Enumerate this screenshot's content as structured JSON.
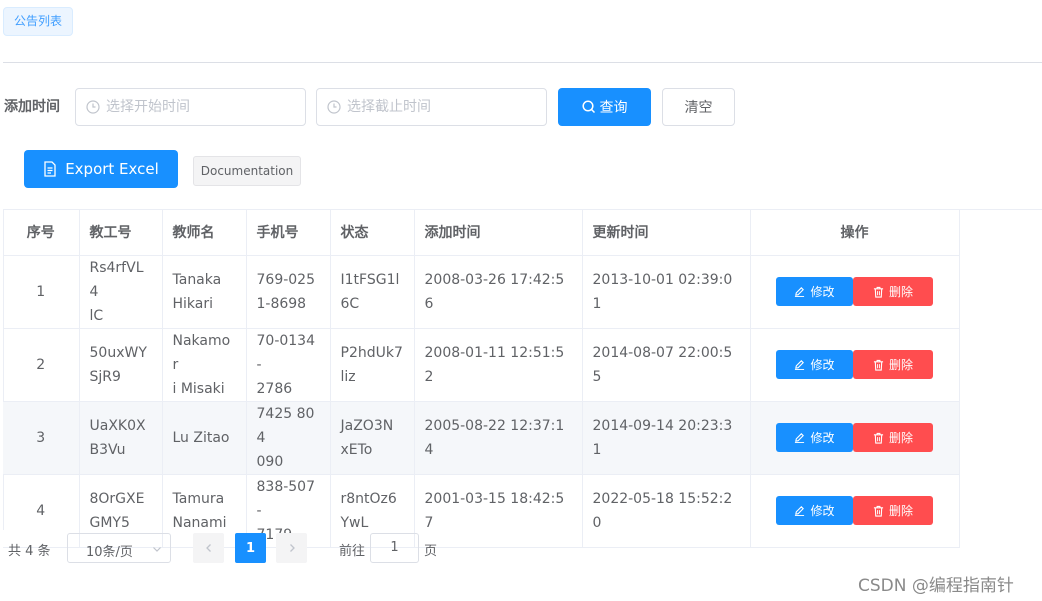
{
  "tab": {
    "label": "公告列表"
  },
  "filters": {
    "label": "添加时间",
    "start_placeholder": "选择开始时间",
    "end_placeholder": "选择截止时间",
    "search_label": "查询",
    "clear_label": "清空"
  },
  "toolbar": {
    "export_label": "Export Excel",
    "doc_label": "Documentation"
  },
  "table": {
    "columns": [
      "序号",
      "教工号",
      "教师名",
      "手机号",
      "状态",
      "添加时间",
      "更新时间",
      "操作"
    ],
    "rows": [
      {
        "index": "1",
        "id_line1": "Rs4rfVL4",
        "id_line2": "lC",
        "name_line1": "Tanaka",
        "name_line2": "Hikari",
        "phone_line1": "769-025",
        "phone_line2": "1-8698",
        "status_line1": "I1tFSG1l",
        "status_line2": "6C",
        "created": "2008-03-26 17:42:56",
        "updated": "2013-10-01 02:39:01"
      },
      {
        "index": "2",
        "id_line1": "50uxWY",
        "id_line2": "SjR9",
        "name_line1": "Nakamor",
        "name_line2": "i Misaki",
        "phone_line1": "70-0134-",
        "phone_line2": "2786",
        "status_line1": "P2hdUk7",
        "status_line2": "liz",
        "created": "2008-01-11 12:51:52",
        "updated": "2014-08-07 22:00:55"
      },
      {
        "index": "3",
        "id_line1": "UaXK0X",
        "id_line2": "B3Vu",
        "name_line1": "Lu Zitao",
        "name_line2": "",
        "phone_line1": "7425 804",
        "phone_line2": "090",
        "status_line1": "JaZO3N",
        "status_line2": "xETo",
        "created": "2005-08-22 12:37:14",
        "updated": "2014-09-14 20:23:31"
      },
      {
        "index": "4",
        "id_line1": "8OrGXE",
        "id_line2": "GMY5",
        "name_line1": "Tamura",
        "name_line2": "Nanami",
        "phone_line1": "838-507-",
        "phone_line2": "7179",
        "status_line1": "r8ntOz6",
        "status_line2": "YwL",
        "created": "2001-03-15 18:42:57",
        "updated": "2022-05-18 15:52:20"
      }
    ],
    "edit_label": "修改",
    "delete_label": "删除"
  },
  "pagination": {
    "total": "共 4 条",
    "page_size": "10条/页",
    "current_page": "1",
    "goto_label": "前往",
    "goto_value": "1",
    "page_suffix": "页"
  },
  "watermark": "CSDN @编程指南针",
  "colors": {
    "primary": "#1890ff",
    "danger": "#ff4d4f",
    "border": "#ebeef5"
  }
}
